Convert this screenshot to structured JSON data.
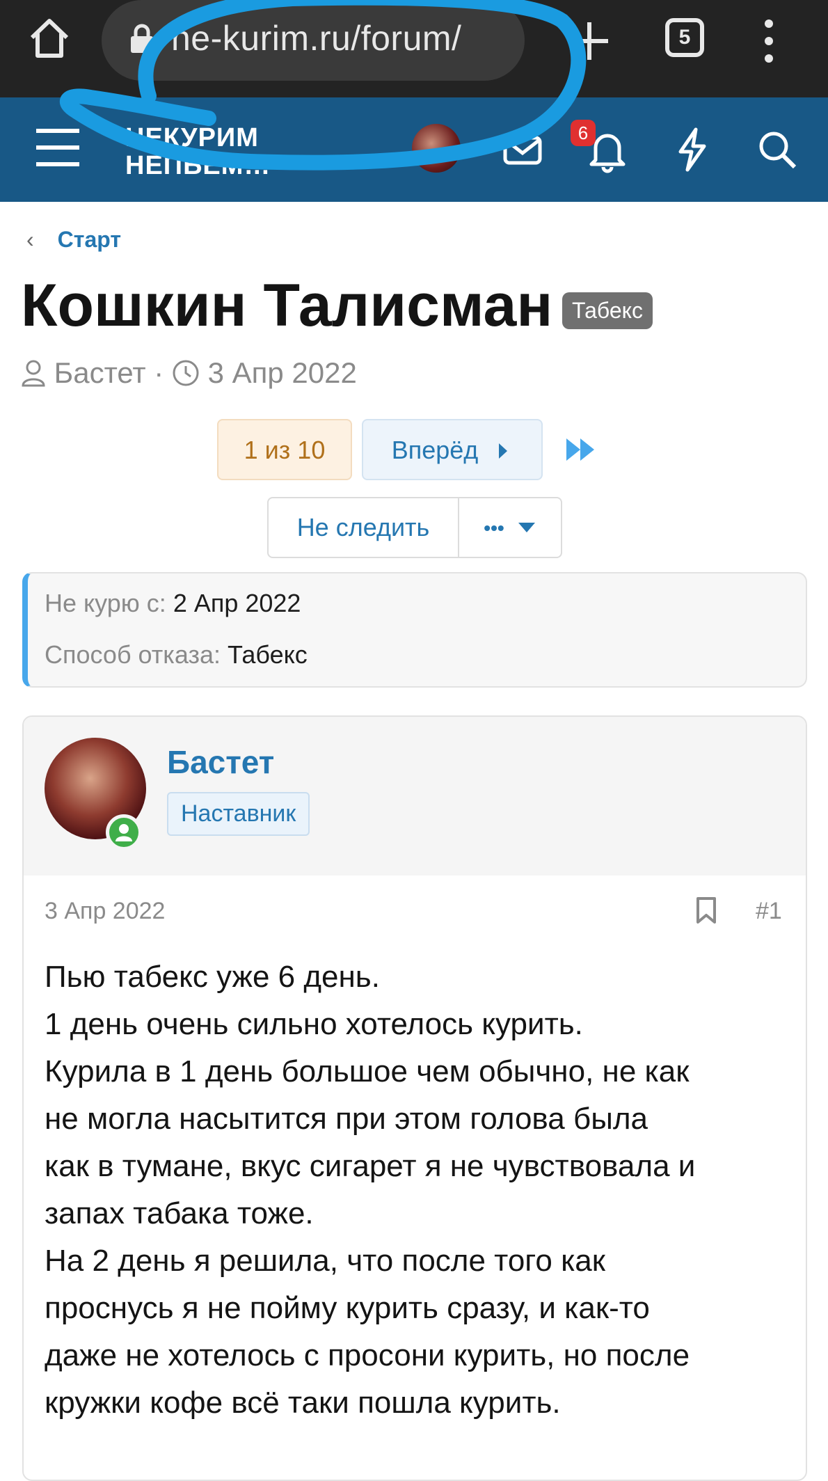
{
  "browser": {
    "url": "ne-kurim.ru/forum/",
    "tab_count": "5"
  },
  "header": {
    "logo_line1": "НЕКУРИМ",
    "logo_line2": "НЕПЬЕМ…",
    "notification_count": "6"
  },
  "breadcrumb": {
    "label": "Старт"
  },
  "thread": {
    "title": "Кошкин Талисман",
    "prefix": "Табекс",
    "author": "Бастет",
    "date": "3 Апр 2022"
  },
  "pagination": {
    "current": "1 из 10",
    "next_label": "Вперёд"
  },
  "actions": {
    "follow_label": "Не следить",
    "more_label": "•••"
  },
  "custom_fields": [
    {
      "label": "Не курю с:",
      "value": "2 Апр 2022"
    },
    {
      "label": "Способ отказа:",
      "value": "Табекс"
    }
  ],
  "post": {
    "username": "Бастет",
    "user_title": "Наставник",
    "date": "3 Апр 2022",
    "number": "#1",
    "body_lines": [
      "Пью табекс уже 6 день.",
      "1 день очень сильно хотелось курить.",
      "Курила в 1 день большое чем обычно, не как",
      "не могла насытится при этом голова была",
      "как в тумане, вкус сигарет я не чувствовала и",
      "запах табака тоже.",
      "На 2 день я решила, что после того как",
      "проснусь я не пойму курить сразу, и как-то",
      "даже не хотелось с просони курить, но после",
      "кружки кофе всё таки пошла курить."
    ]
  },
  "colors": {
    "header_bg": "#185886",
    "link": "#2577b1",
    "annotation": "#1a9be0"
  }
}
